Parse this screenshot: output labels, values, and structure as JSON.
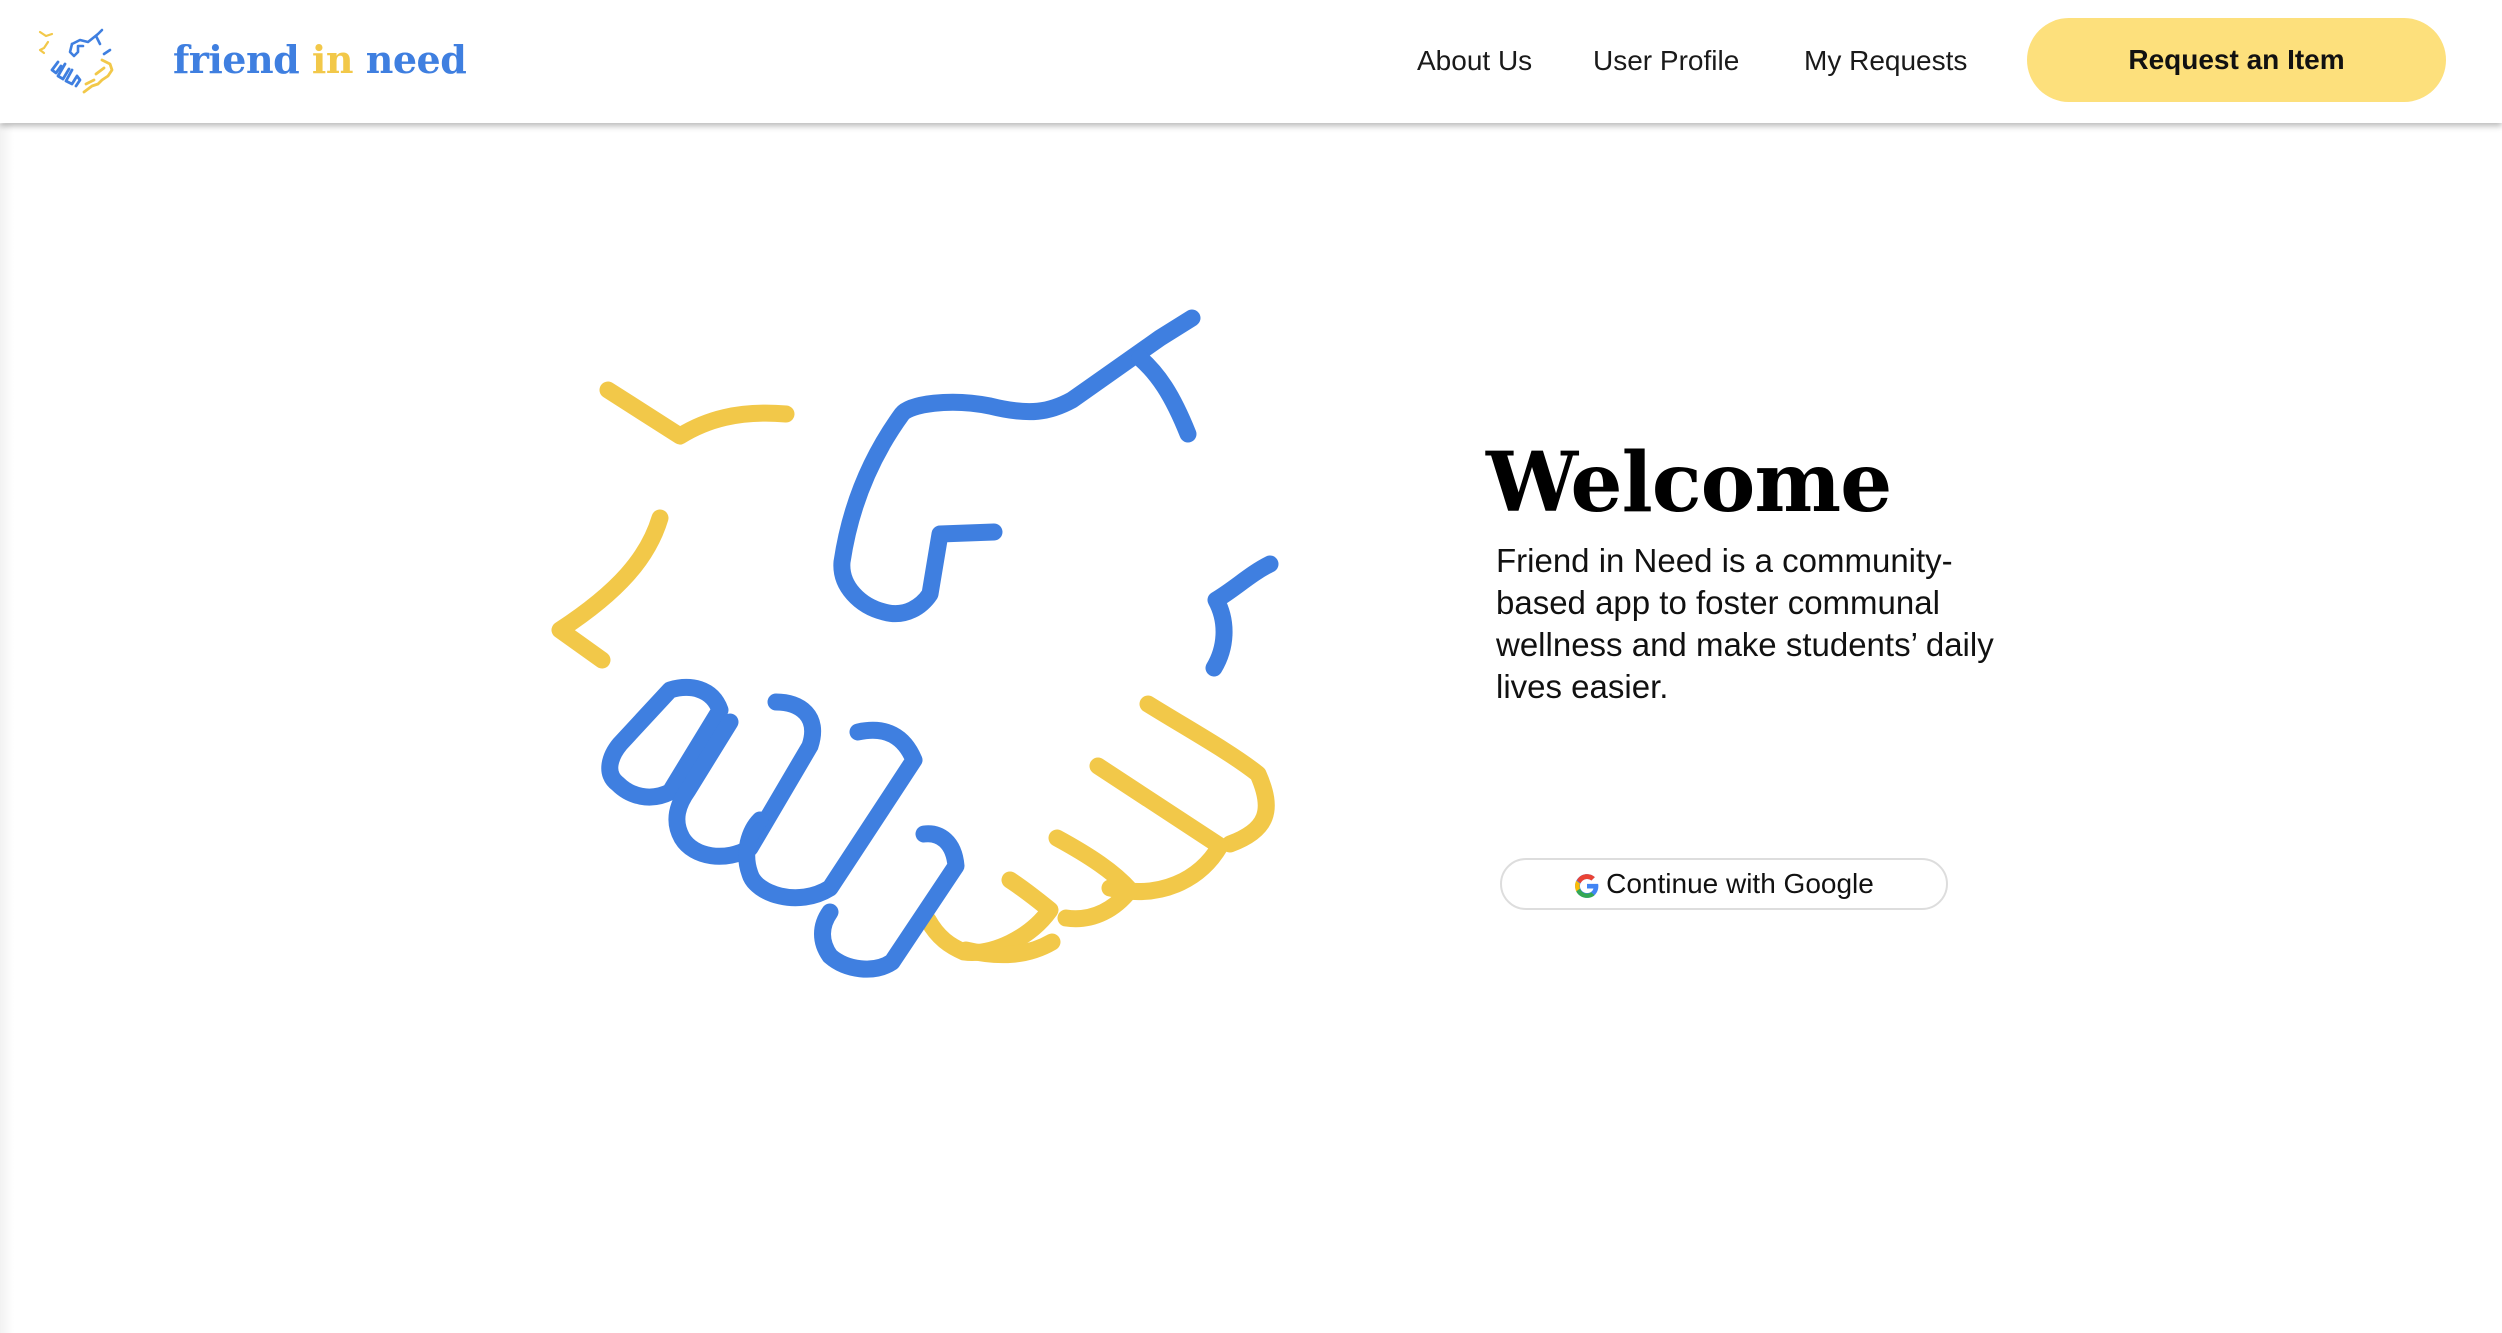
{
  "header": {
    "brand": {
      "word1": "friend",
      "word2": "in",
      "word3": "need"
    },
    "nav": {
      "about": "About Us",
      "profile": "User Profile",
      "requests": "My Requests"
    },
    "cta_label": "Request an Item"
  },
  "hero": {
    "title": "Welcome",
    "description": "Friend in Need is a community-based app to foster communal wellness and make students’ daily lives easier.",
    "google_button_label": "Continue with Google",
    "illustration": "handshake-icon"
  },
  "colors": {
    "blue": "#3f7fe0",
    "yellow": "#f2c849",
    "cta_background": "#fde07c",
    "text": "#111111"
  }
}
